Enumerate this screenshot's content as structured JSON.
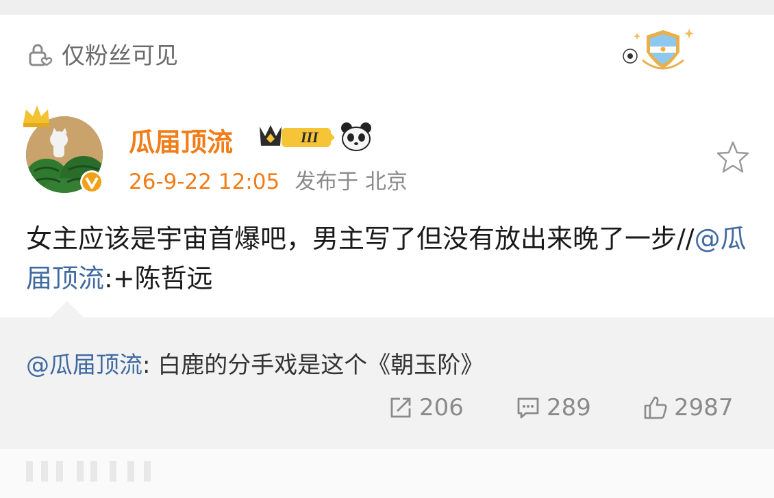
{
  "privacy_label": "仅粉丝可见",
  "author": {
    "name": "瓜届顶流",
    "vip_level": "III"
  },
  "post": {
    "time": "26-9-22 12:05",
    "location": "发布于 北京",
    "text_parts": [
      "女主应该是宇宙首爆吧，男主写了但没有放出来晚了一步//",
      "@瓜届顶流",
      ":+陈哲远"
    ]
  },
  "repost": {
    "mention": "@瓜届顶流",
    "text": ": 白鹿的分手戏是这个《朝玉阶》"
  },
  "actions": {
    "share_count": "206",
    "comment_count": "289",
    "like_count": "2987"
  },
  "colors": {
    "accent": "#f07d18",
    "mention": "#3f6aa0",
    "muted": "#8a8a8a",
    "repost_bg": "#f2f2f2"
  }
}
